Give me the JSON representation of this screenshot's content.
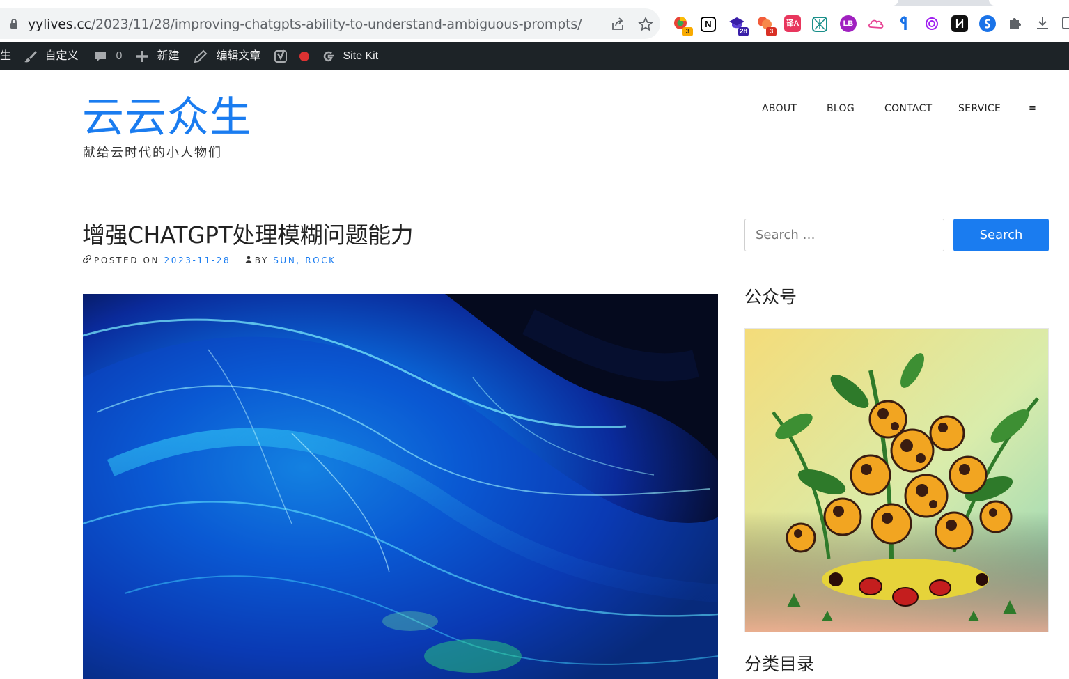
{
  "browser": {
    "url_host": "yylives.cc",
    "url_path": "/2023/11/28/improving-chatgpts-ability-to-understand-ambiguous-prompts/",
    "extensions": [
      {
        "name": "ext-chrome-icon",
        "badge": "3"
      },
      {
        "name": "ext-notion-icon",
        "badge": ""
      },
      {
        "name": "ext-graduation-icon",
        "badge": "28"
      },
      {
        "name": "ext-red-icon",
        "badge": "3"
      },
      {
        "name": "ext-translate-icon",
        "badge": ""
      },
      {
        "name": "ext-pattern-icon",
        "badge": ""
      },
      {
        "name": "ext-purple-icon",
        "badge": ""
      },
      {
        "name": "ext-cloud-icon",
        "badge": ""
      },
      {
        "name": "ext-blue-mark-icon",
        "badge": ""
      },
      {
        "name": "ext-openai-icon",
        "badge": ""
      },
      {
        "name": "ext-black-icon",
        "badge": ""
      },
      {
        "name": "ext-blue-circle-icon",
        "badge": ""
      }
    ]
  },
  "adminbar": {
    "site_fragment": "生",
    "customize": "自定义",
    "comments_count": "0",
    "new": "新建",
    "edit_post": "编辑文章",
    "sitekit": "Site Kit"
  },
  "site": {
    "title": "云云众生",
    "tagline": "献给云时代的小人物们"
  },
  "nav": {
    "items": [
      "ABOUT",
      "BLOG",
      "CONTACT",
      "SERVICE"
    ],
    "menu_toggle": "≡"
  },
  "post": {
    "title": "增强CHATGPT处理模糊问题能力",
    "posted_on_label": "POSTED ON",
    "date": "2023-11-28",
    "by_label": "BY",
    "author": "SUN, ROCK"
  },
  "sidebar": {
    "search_placeholder": "Search …",
    "search_button": "Search",
    "widget1_title": "公众号",
    "widget2_title": "分类目录"
  },
  "colors": {
    "accent": "#1a7cf0",
    "adminbar": "#1d2327"
  }
}
